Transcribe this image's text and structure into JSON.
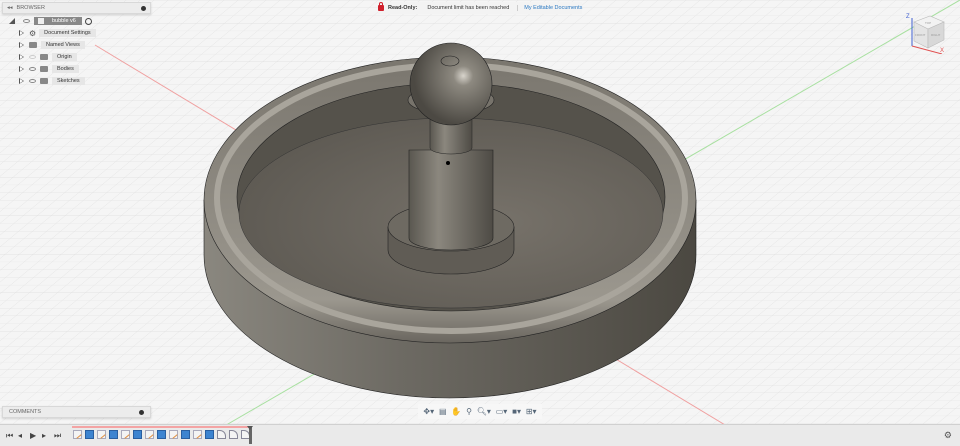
{
  "browser": {
    "title": "BROWSER",
    "root": "bubble v6",
    "items": [
      {
        "label": "Document Settings",
        "icon": "gear-icon"
      },
      {
        "label": "Named Views",
        "icon": "folder-icon"
      },
      {
        "label": "Origin",
        "icon": "folder-icon"
      },
      {
        "label": "Bodies",
        "icon": "folder-icon"
      },
      {
        "label": "Sketches",
        "icon": "folder-icon"
      }
    ]
  },
  "banner": {
    "readonly_label": "Read-Only:",
    "message": "Document limit has been reached",
    "link": "My Editable Documents"
  },
  "comments": {
    "title": "COMMENTS"
  },
  "viewcube": {
    "top": "TOP",
    "front": "FRONT",
    "right": "RIGHT",
    "x_axis": "X",
    "z_axis": "Z"
  },
  "navbar": {
    "icons": [
      "orbit-icon",
      "look-at-icon",
      "pan-icon",
      "zoom-window-icon",
      "zoom-icon",
      "display-settings-icon",
      "visual-style-icon",
      "grid-settings-icon"
    ]
  },
  "timeline": {
    "items": [
      "sketch",
      "extrude",
      "sketch",
      "extrude",
      "sketch",
      "extrude",
      "sketch",
      "extrude",
      "sketch",
      "extrude",
      "sketch",
      "extrude",
      "fillet",
      "fillet",
      "fillet"
    ]
  },
  "colors": {
    "accent": "#2a78c2",
    "readonly": "#d0202c",
    "body": "#6e6a62"
  }
}
